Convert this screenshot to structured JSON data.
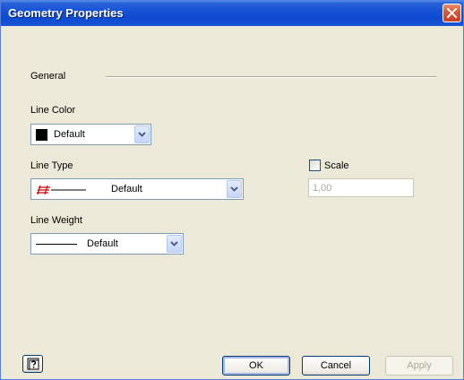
{
  "window": {
    "title": "Geometry Properties"
  },
  "general": {
    "section_label": "General"
  },
  "line_color": {
    "label": "Line Color",
    "value": "Default",
    "swatch_color": "#000000"
  },
  "line_type": {
    "label": "Line Type",
    "value": "Default",
    "icon_color": "#cc0000"
  },
  "scale": {
    "checkbox_label": "Scale",
    "checked": false,
    "value": "1,00"
  },
  "line_weight": {
    "label": "Line Weight",
    "value": "Default"
  },
  "buttons": {
    "help_icon": "help-question-icon",
    "ok_label": "OK",
    "cancel_label": "Cancel",
    "apply_label": "Apply"
  },
  "colors": {
    "titlebar": "#0d4ad0",
    "dialog_bg": "#ece9d8",
    "close_button": "#d8553a"
  }
}
